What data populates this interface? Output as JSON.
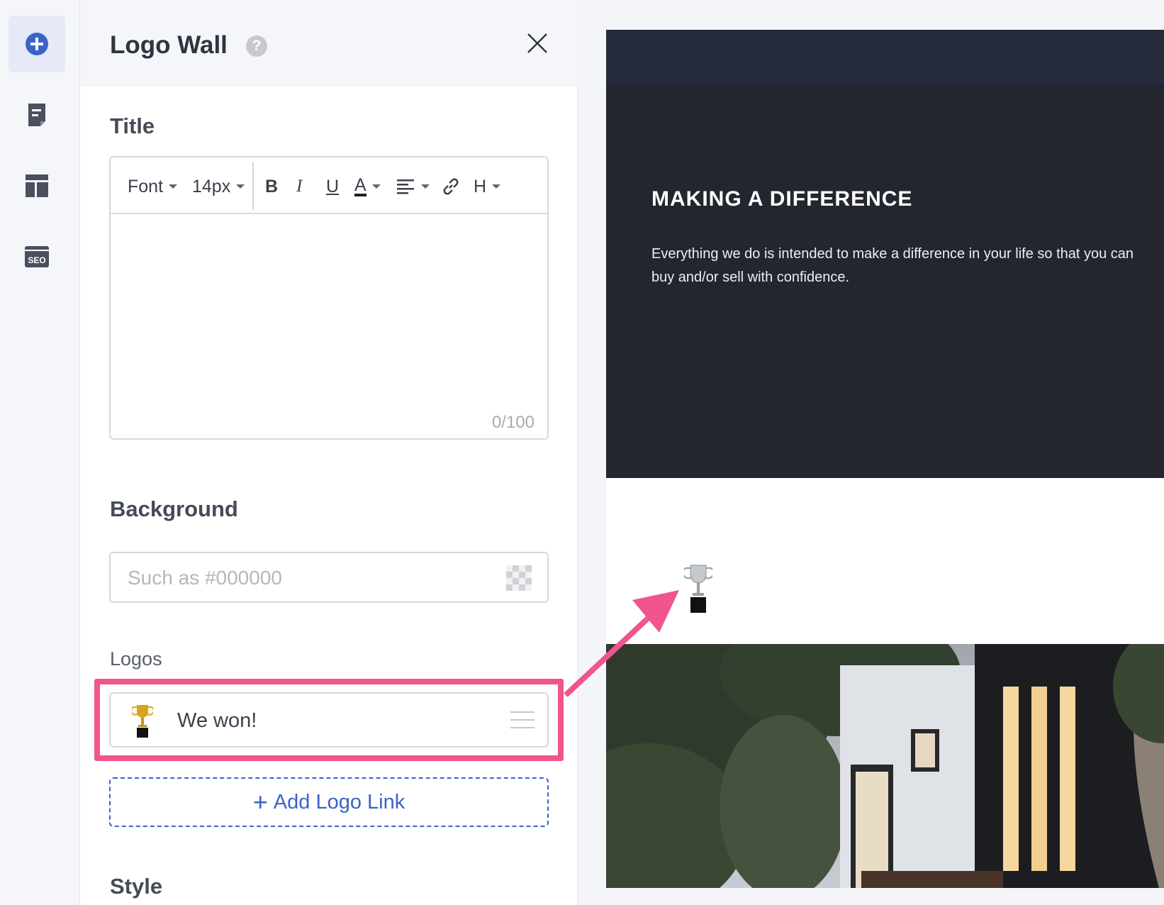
{
  "sidebar": {
    "items": [
      {
        "icon": "add-circle-icon",
        "active": true
      },
      {
        "icon": "page-icon",
        "active": false
      },
      {
        "icon": "layout-icon",
        "active": false
      },
      {
        "icon": "seo-icon",
        "label": "SEO",
        "active": false
      }
    ]
  },
  "panel": {
    "title": "Logo Wall",
    "help": "?",
    "title_section": {
      "label": "Title",
      "toolbar": {
        "font": "Font",
        "size": "14px",
        "bold": "B",
        "italic": "I",
        "underline": "U",
        "color": "A",
        "heading": "H"
      },
      "counter": "0/100"
    },
    "background_section": {
      "label": "Background",
      "placeholder": "Such as #000000"
    },
    "logos_section": {
      "label": "Logos",
      "items": [
        {
          "name": "We won!",
          "icon": "trophy-icon"
        }
      ],
      "add_label": "Add Logo Link"
    },
    "style_section": {
      "label": "Style"
    }
  },
  "preview": {
    "heading": "MAKING A DIFFERENCE",
    "body": "Everything we do is intended to make a difference in your life so that you can buy and/or sell with confidence."
  },
  "colors": {
    "accent": "#3c63c7",
    "highlight": "#f0558e",
    "hero_bg": "#23262f",
    "nav_bg": "#252b3b"
  }
}
